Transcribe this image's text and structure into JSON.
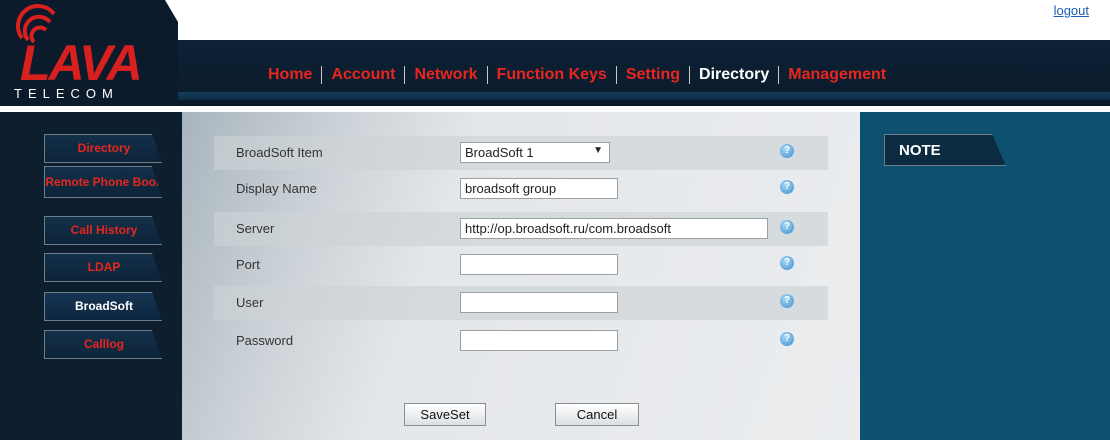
{
  "header": {
    "logo_main": "LAVA",
    "logo_sub": "TELECOM",
    "logout": "logout"
  },
  "nav": {
    "items": [
      "Home",
      "Account",
      "Network",
      "Function Keys",
      "Setting",
      "Directory",
      "Management"
    ],
    "active": "Directory"
  },
  "sidebar": {
    "items": [
      {
        "label": "Directory"
      },
      {
        "label": "Remote Phone Book"
      },
      {
        "label": "Call History"
      },
      {
        "label": "LDAP"
      },
      {
        "label": "BroadSoft"
      },
      {
        "label": "Calllog"
      }
    ],
    "active": "BroadSoft"
  },
  "form": {
    "broadsoft_item": {
      "label": "BroadSoft Item",
      "value": "BroadSoft 1"
    },
    "display_name": {
      "label": "Display Name",
      "value": "broadsoft group"
    },
    "server": {
      "label": "Server",
      "value": "http://op.broadsoft.ru/com.broadsoft"
    },
    "port": {
      "label": "Port",
      "value": ""
    },
    "user": {
      "label": "User",
      "value": ""
    },
    "password": {
      "label": "Password",
      "value": ""
    },
    "help_glyph": "?",
    "save_label": "SaveSet",
    "cancel_label": "Cancel"
  },
  "note": {
    "title": "NOTE"
  },
  "colors": {
    "accent_red": "#e8261f",
    "header_dark": "#0c1b2c",
    "note_panel": "#0e506f",
    "link_blue": "#1a5fb4"
  }
}
